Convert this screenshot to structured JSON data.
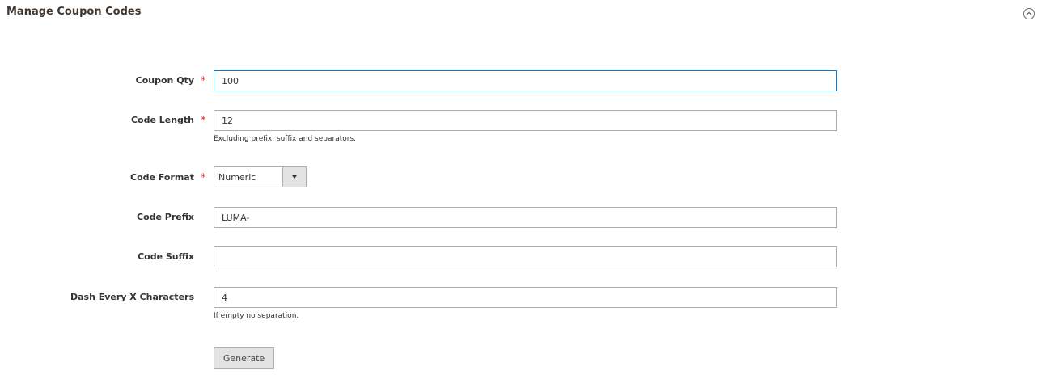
{
  "section": {
    "title": "Manage Coupon Codes"
  },
  "fields": {
    "coupon_qty": {
      "label": "Coupon Qty",
      "required_mark": "*",
      "value": "100"
    },
    "code_length": {
      "label": "Code Length",
      "required_mark": "*",
      "value": "12",
      "note": "Excluding prefix, suffix and separators."
    },
    "code_format": {
      "label": "Code Format",
      "required_mark": "*",
      "selected": "Numeric"
    },
    "code_prefix": {
      "label": "Code Prefix",
      "value": "LUMA-"
    },
    "code_suffix": {
      "label": "Code Suffix",
      "value": ""
    },
    "dash_every": {
      "label": "Dash Every X Characters",
      "value": "4",
      "note": "If empty no separation."
    }
  },
  "actions": {
    "generate_label": "Generate"
  },
  "colors": {
    "required": "#e22626",
    "focus_border": "#007bdb"
  },
  "icons": {
    "collapse": "chevron-up-circle-icon",
    "dropdown": "caret-down-icon"
  }
}
